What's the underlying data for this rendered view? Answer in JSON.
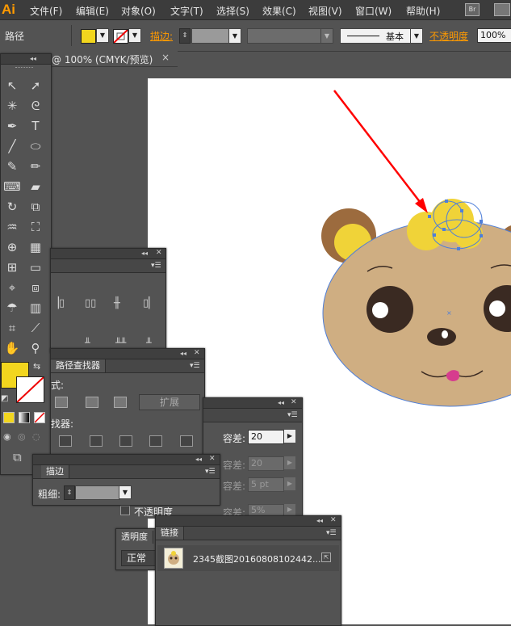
{
  "app": {
    "logo": "Ai"
  },
  "menu": [
    "文件(F)",
    "编辑(E)",
    "对象(O)",
    "文字(T)",
    "选择(S)",
    "效果(C)",
    "视图(V)",
    "窗口(W)",
    "帮助(H)"
  ],
  "bridge_badge": "Br",
  "control": {
    "object_type": "路径",
    "stroke_label": "描边:",
    "stroke_style": "基本",
    "opacity_label": "不透明度",
    "opacity_value": "100%",
    "fill_color": "#f2d61e"
  },
  "document_tab": {
    "title": "@ 100% (CMYK/预览)",
    "close": "×"
  },
  "pathfinder_panel": {
    "tab": "路径查找器",
    "shape_modes_label": "式:",
    "expand_button": "扩展",
    "pathfinders_label": "找器:"
  },
  "options_panel": {
    "tolerance_label": "容差:",
    "tolerance_value": "20",
    "tolerance2_value": "20",
    "tolerance3_value": "5 pt",
    "tolerance4_value": "5%",
    "opacity_checkbox_label": "不透明度"
  },
  "stroke_panel": {
    "tab": "描边",
    "weight_label": "粗细:"
  },
  "transparency_panel": {
    "tab": "透明度",
    "blend_mode": "正常"
  },
  "links_panel": {
    "tab": "链接",
    "item_name": "2345截图20160808102442..."
  },
  "colors": {
    "fill": "#f2d61e",
    "bear_face": "#cfae82",
    "bear_ear": "#9c6b3e",
    "selection": "#4f7fd9",
    "arrow": "#ff0000",
    "app_logo": "#ff9a00"
  }
}
